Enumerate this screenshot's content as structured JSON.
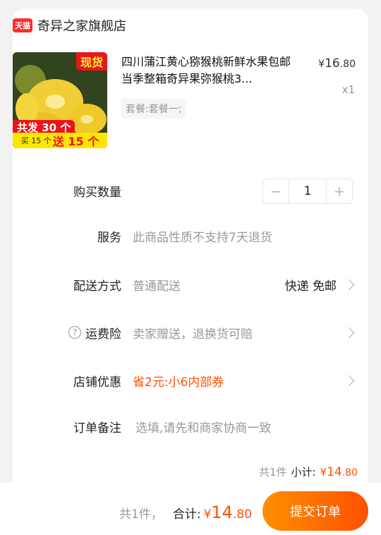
{
  "shop": {
    "badge": "天猫",
    "name": "奇异之家旗舰店"
  },
  "product": {
    "title": "四川蒲江黄心猕猴桃新鲜水果包邮当季整箱奇异果弥猴桃3...",
    "price": {
      "currency": "¥",
      "int": "16",
      "dec": ".80"
    },
    "qty_text": "x1",
    "sku": "套餐:套餐一;",
    "image_banners": {
      "top": "现货",
      "mid": "共发 30 个",
      "bottom_small": "买 15 个",
      "bottom_big": "送 15 个"
    }
  },
  "rows": {
    "quantity": {
      "label": "购买数量",
      "minus": "−",
      "value": "1",
      "plus": "+"
    },
    "service": {
      "label": "服务",
      "value": "此商品性质不支持7天退货"
    },
    "delivery": {
      "label": "配送方式",
      "value": "普通配送",
      "right": "快递 免邮"
    },
    "insurance": {
      "icon": "?",
      "label": "运费险",
      "value": "卖家赠送，退换货可赔"
    },
    "promo": {
      "label": "店铺优惠",
      "value": "省2元:小6内部券"
    },
    "note": {
      "label": "订单备注",
      "placeholder": "选填,请先和商家协商一致"
    }
  },
  "subtotal": {
    "count": "共1件",
    "label": "小计:",
    "currency": "¥",
    "int": "14",
    "dec": ".80"
  },
  "bottom": {
    "count": "共1件，",
    "label": "合计:",
    "currency": "¥",
    "int": "14",
    "dec": ".80",
    "submit": "提交订单"
  },
  "colors": {
    "accent": "#ff5000",
    "tmall_red": "#ff2c2c"
  }
}
